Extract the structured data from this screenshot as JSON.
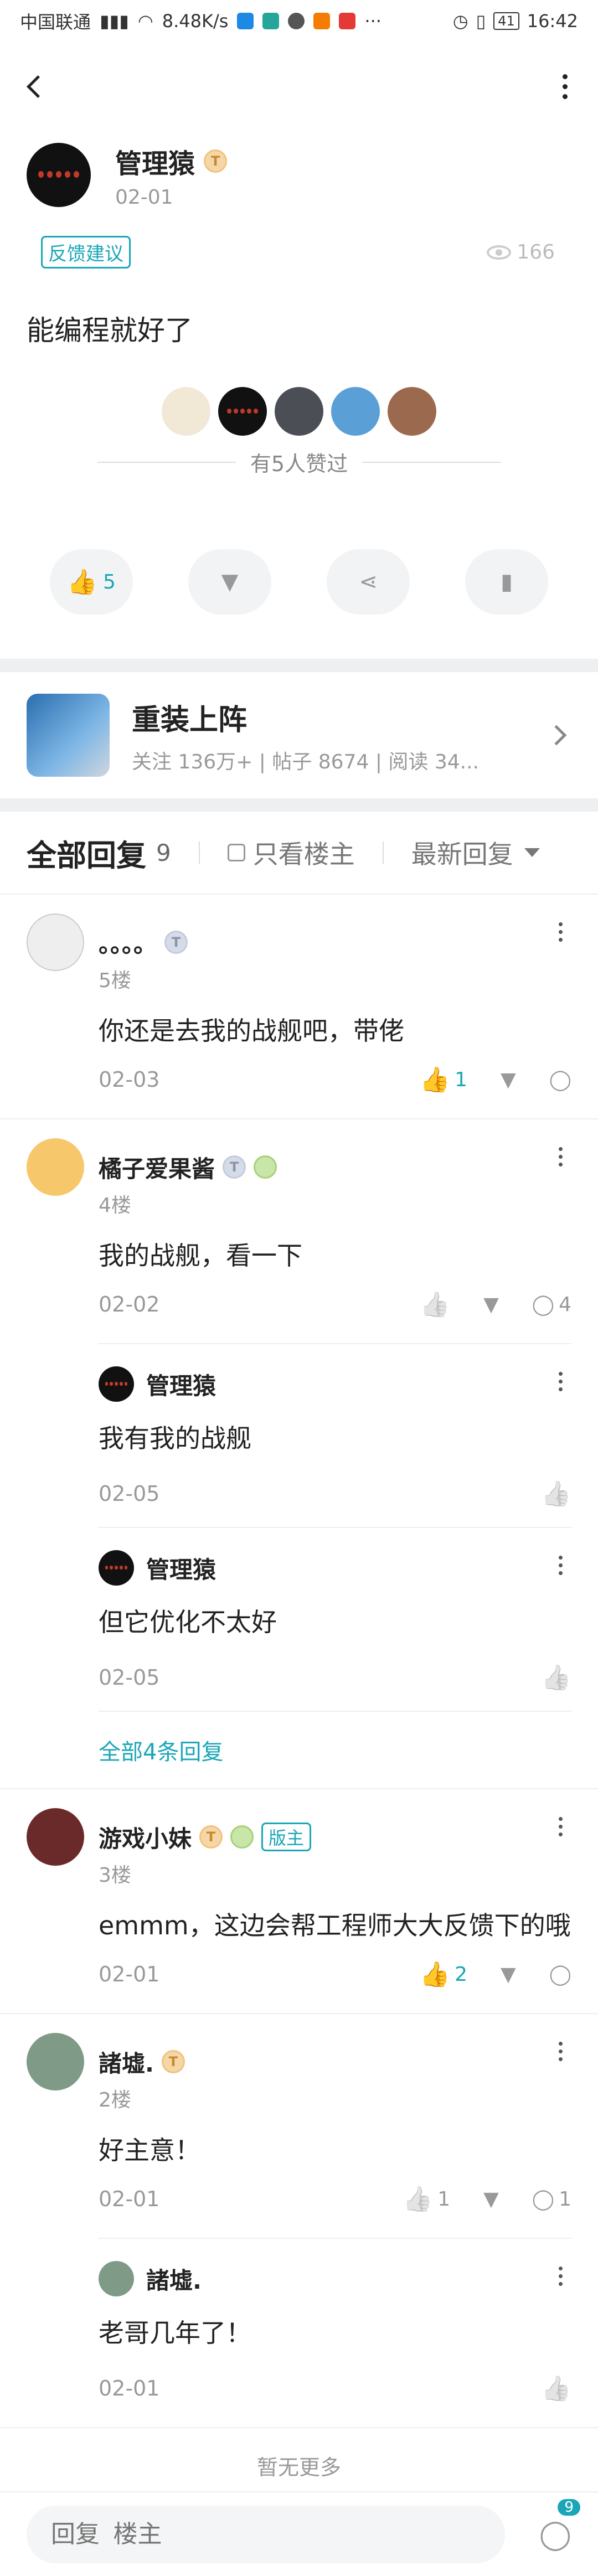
{
  "status_bar": {
    "carrier": "中国联通",
    "net_speed": "8.48K/s",
    "battery": "41",
    "time": "16:42"
  },
  "post": {
    "author": "管理猿",
    "author_badge": "T",
    "date": "02-01",
    "tag": "反馈建议",
    "views": "166",
    "content": "能编程就好了",
    "liked_text": "有5人赞过",
    "like_count": "5"
  },
  "forum": {
    "title": "重装上阵",
    "stats": "关注 136万+ | 帖子 8674 | 阅读 34..."
  },
  "replies_header": {
    "title": "全部回复",
    "count": "9",
    "only_op": "只看楼主",
    "sort": "最新回复"
  },
  "comments": [
    {
      "name": "。。。。",
      "badge": "T",
      "floor": "5楼",
      "text": "你还是去我的战舰吧，带佬",
      "date": "02-03",
      "likes": "1",
      "comments": ""
    },
    {
      "name": "橘子爱果酱",
      "badge": "T",
      "floor": "4楼",
      "text": "我的战舰，看一下",
      "date": "02-02",
      "likes": "",
      "comments": "4",
      "subs": [
        {
          "name": "管理猿",
          "text": "我有我的战舰",
          "date": "02-05"
        },
        {
          "name": "管理猿",
          "text": "但它优化不太好",
          "date": "02-05"
        }
      ],
      "more": "全部4条回复"
    },
    {
      "name": "游戏小妹",
      "badge": "T",
      "mod": "版主",
      "floor": "3楼",
      "text": "emmm，这边会帮工程师大大反馈下的哦",
      "date": "02-01",
      "likes": "2",
      "comments": ""
    },
    {
      "name": "諸墟.",
      "badge": "T",
      "floor": "2楼",
      "text": "好主意！",
      "date": "02-01",
      "likes": "1",
      "comments": "1",
      "subs": [
        {
          "name": "諸墟.",
          "text": "老哥几年了！",
          "date": "02-01"
        }
      ]
    }
  ],
  "no_more": "暂无更多",
  "bottom": {
    "placeholder": "回复  楼主",
    "comment_badge": "9"
  },
  "colors": {
    "accent": "#1aa6b7"
  }
}
